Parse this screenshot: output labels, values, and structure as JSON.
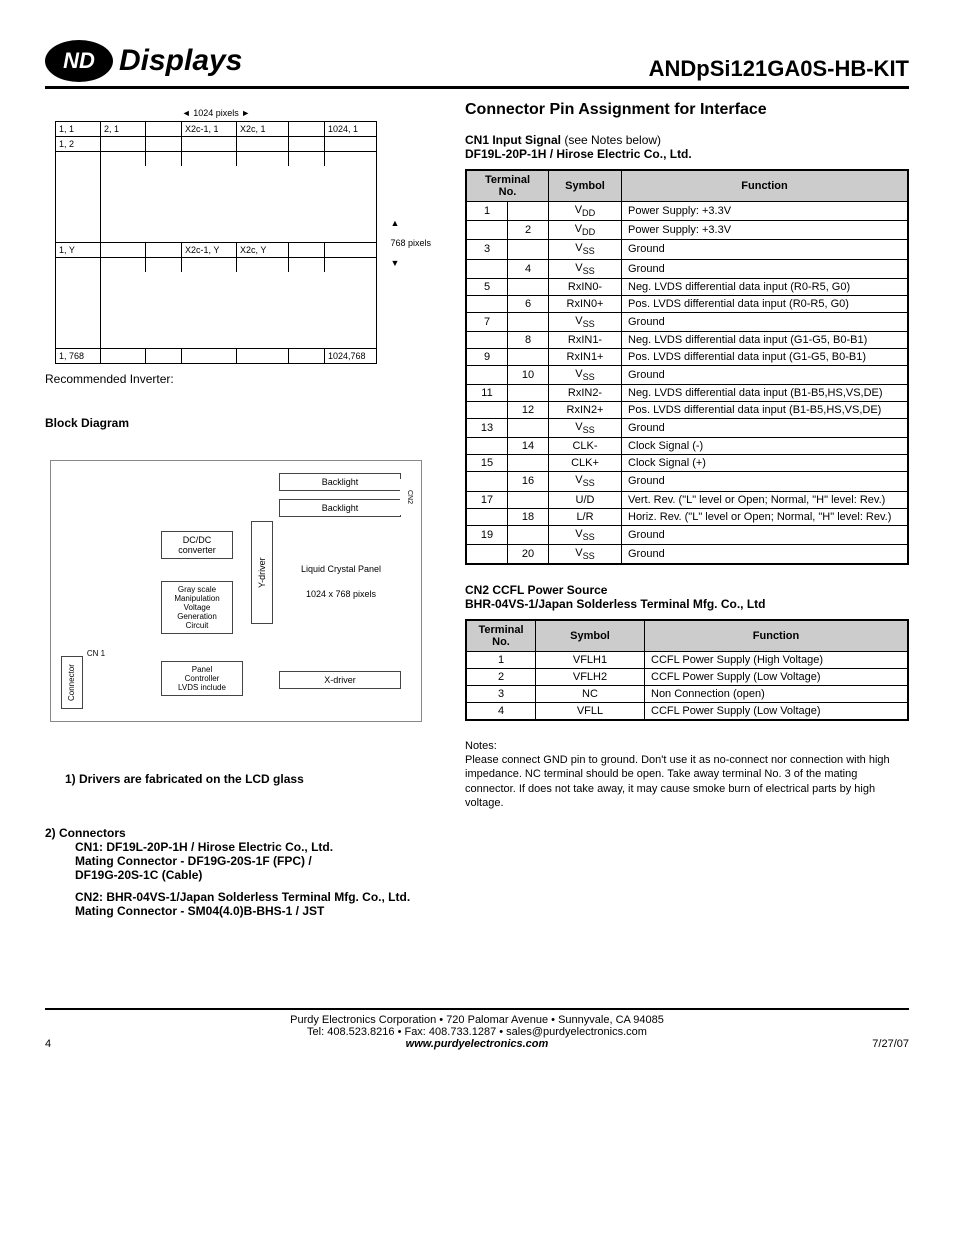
{
  "header": {
    "logo_nd": "ND",
    "logo_displays": "Displays",
    "part_number": "ANDpSi121GA0S-HB-KIT"
  },
  "pixel_diagram": {
    "top_label": "1024 pixels",
    "right_label": "768 pixels",
    "r1": {
      "c1": "1, 1",
      "c2": "2, 1",
      "c3": "X2c-1, 1",
      "c4": "X2c, 1",
      "c5": "1024, 1"
    },
    "r2": {
      "c1": "1, 2"
    },
    "r3": {
      "c1": "1, Y",
      "c3": "X2c-1, Y",
      "c4": "X2c, Y"
    },
    "r4": {
      "c1": "1, 768",
      "c5": "1024,768"
    }
  },
  "recommended_inverter": "Recommended Inverter:",
  "block_diagram_title": "Block Diagram",
  "block_diagram": {
    "backlight1": "Backlight",
    "backlight2": "Backlight",
    "dcdc": "DC/DC\nconverter",
    "ydriver": "Y-driver",
    "lcp": "Liquid Crystal Panel",
    "lcp_res": "1024 x 768 pixels",
    "gray": "Gray scale\nManipulation\nVoltage\nGeneration\nCircuit",
    "cn1": "CN 1",
    "connector": "Connector",
    "panel": "Panel\nController\nLVDS include",
    "xdriver": "X-driver",
    "cn2": "CN2"
  },
  "note1": "1) Drivers are fabricated on the LCD glass",
  "connectors": {
    "title": "2) Connectors",
    "cn1_line1": "CN1: DF19L-20P-1H / Hirose Electric Co., Ltd.",
    "cn1_line2": "Mating Connector - DF19G-20S-1F (FPC) /",
    "cn1_line3": "DF19G-20S-1C (Cable)",
    "cn2_line1": "CN2: BHR-04VS-1/Japan Solderless Terminal Mfg. Co., Ltd.",
    "cn2_line2": "Mating Connector - SM04(4.0)B-BHS-1 / JST"
  },
  "right": {
    "title": "Connector Pin Assignment for Interface",
    "cn1_title": "CN1 Input Signal",
    "cn1_note": " (see Notes below)",
    "cn1_part": "DF19L-20P-1H / Hirose Electric Co., Ltd.",
    "table1_headers": {
      "terminal": "Terminal\nNo.",
      "symbol": "Symbol",
      "function": "Function"
    },
    "table1_rows": [
      {
        "a": "1",
        "b": "",
        "sym": "V<sub>DD</sub>",
        "func": "Power Supply: +3.3V"
      },
      {
        "a": "",
        "b": "2",
        "sym": "V<sub>DD</sub>",
        "func": "Power Supply: +3.3V"
      },
      {
        "a": "3",
        "b": "",
        "sym": "V<sub>SS</sub>",
        "func": "Ground"
      },
      {
        "a": "",
        "b": "4",
        "sym": "V<sub>SS</sub>",
        "func": "Ground"
      },
      {
        "a": "5",
        "b": "",
        "sym": "RxIN0-",
        "func": "Neg. LVDS differential data input (R0-R5, G0)"
      },
      {
        "a": "",
        "b": "6",
        "sym": "RxIN0+",
        "func": "Pos. LVDS differential data input (R0-R5, G0)"
      },
      {
        "a": "7",
        "b": "",
        "sym": "V<sub>SS</sub>",
        "func": "Ground"
      },
      {
        "a": "",
        "b": "8",
        "sym": "RxIN1-",
        "func": "Neg. LVDS differential data input (G1-G5, B0-B1)"
      },
      {
        "a": "9",
        "b": "",
        "sym": "RxIN1+",
        "func": "Pos. LVDS differential data input (G1-G5, B0-B1)"
      },
      {
        "a": "",
        "b": "10",
        "sym": "V<sub>SS</sub>",
        "func": "Ground"
      },
      {
        "a": "11",
        "b": "",
        "sym": "RxIN2-",
        "func": "Neg. LVDS differential data input (B1-B5,HS,VS,DE)"
      },
      {
        "a": "",
        "b": "12",
        "sym": "RxIN2+",
        "func": "Pos. LVDS differential data input (B1-B5,HS,VS,DE)"
      },
      {
        "a": "13",
        "b": "",
        "sym": "V<sub>SS</sub>",
        "func": "Ground"
      },
      {
        "a": "",
        "b": "14",
        "sym": "CLK-",
        "func": "Clock Signal (-)"
      },
      {
        "a": "15",
        "b": "",
        "sym": "CLK+",
        "func": "Clock Signal (+)"
      },
      {
        "a": "",
        "b": "16",
        "sym": "V<sub>SS</sub>",
        "func": "Ground"
      },
      {
        "a": "17",
        "b": "",
        "sym": "U/D",
        "func": "Vert. Rev. (\"L\" level or Open; Normal, \"H\" level: Rev.)"
      },
      {
        "a": "",
        "b": "18",
        "sym": "L/R",
        "func": "Horiz. Rev. (\"L\" level or Open; Normal, \"H\" level: Rev.)"
      },
      {
        "a": "19",
        "b": "",
        "sym": "V<sub>SS</sub>",
        "func": "Ground"
      },
      {
        "a": "",
        "b": "20",
        "sym": "V<sub>SS</sub>",
        "func": "Ground"
      }
    ],
    "cn2_title": "CN2 CCFL Power Source",
    "cn2_part": "BHR-04VS-1/Japan Solderless Terminal Mfg. Co., Ltd",
    "table2_rows": [
      {
        "no": "1",
        "sym": "VFLH1",
        "func": "CCFL Power Supply (High Voltage)"
      },
      {
        "no": "2",
        "sym": "VFLH2",
        "func": "CCFL Power Supply (Low Voltage)"
      },
      {
        "no": "3",
        "sym": "NC",
        "func": "Non Connection (open)"
      },
      {
        "no": "4",
        "sym": "VFLL",
        "func": "CCFL Power Supply (Low Voltage)"
      }
    ],
    "notes_title": "Notes:",
    "notes_body": "Please connect GND pin to ground. Don't use it as no-connect nor connection with high impedance. NC terminal should be open. Take away terminal No. 3 of the mating connector. If does not take away, it may cause smoke burn of electrical parts by high voltage."
  },
  "footer": {
    "line1": "Purdy Electronics Corporation  •  720 Palomar Avenue  •  Sunnyvale, CA 94085",
    "line2": "Tel: 408.523.8216  •  Fax: 408.733.1287  •  sales@purdyelectronics.com",
    "website": "www.purdyelectronics.com",
    "page": "4",
    "date": "7/27/07"
  }
}
